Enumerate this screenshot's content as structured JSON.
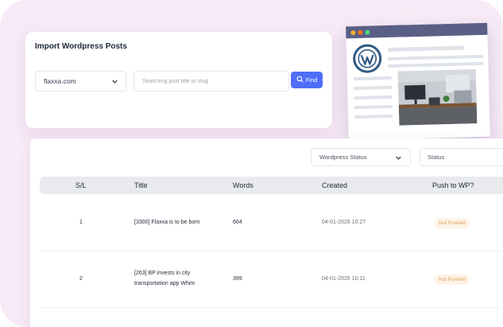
{
  "import_card": {
    "title": "Import Wordpress Posts",
    "site_value": "flaxxa.com",
    "search_placeholder": "Searching post title or slug",
    "find_label": "Find"
  },
  "filters": {
    "wp_status_label": "Wordpress Status",
    "status_label": "Status"
  },
  "table": {
    "headers": [
      "S/L",
      "Title",
      "Words",
      "Created",
      "Push to WP?"
    ],
    "rows": [
      {
        "sl": "1",
        "title_line1": "[3300] Flaxxa is to be born",
        "title_line2": "",
        "words": "664",
        "created": "04-01-2026 10:27",
        "push": "Not Pushed"
      },
      {
        "sl": "2",
        "title_line1": "[263] BP invests in city",
        "title_line2": "transportation app Whim",
        "words": "399",
        "created": "04-01-2026 10:11",
        "push": "Not Pushed"
      }
    ]
  },
  "icons": {
    "select_chevron": "chevron-down-icon",
    "find": "search-icon",
    "wp_logo": "wordpress-logo-icon"
  },
  "colors": {
    "accent": "#4f6ef7",
    "badge_bg": "#fdf3e7",
    "badge_text": "#e8a05a",
    "background_blob": "#f8eaf6",
    "wp_titlebar": "#5a5f86"
  }
}
